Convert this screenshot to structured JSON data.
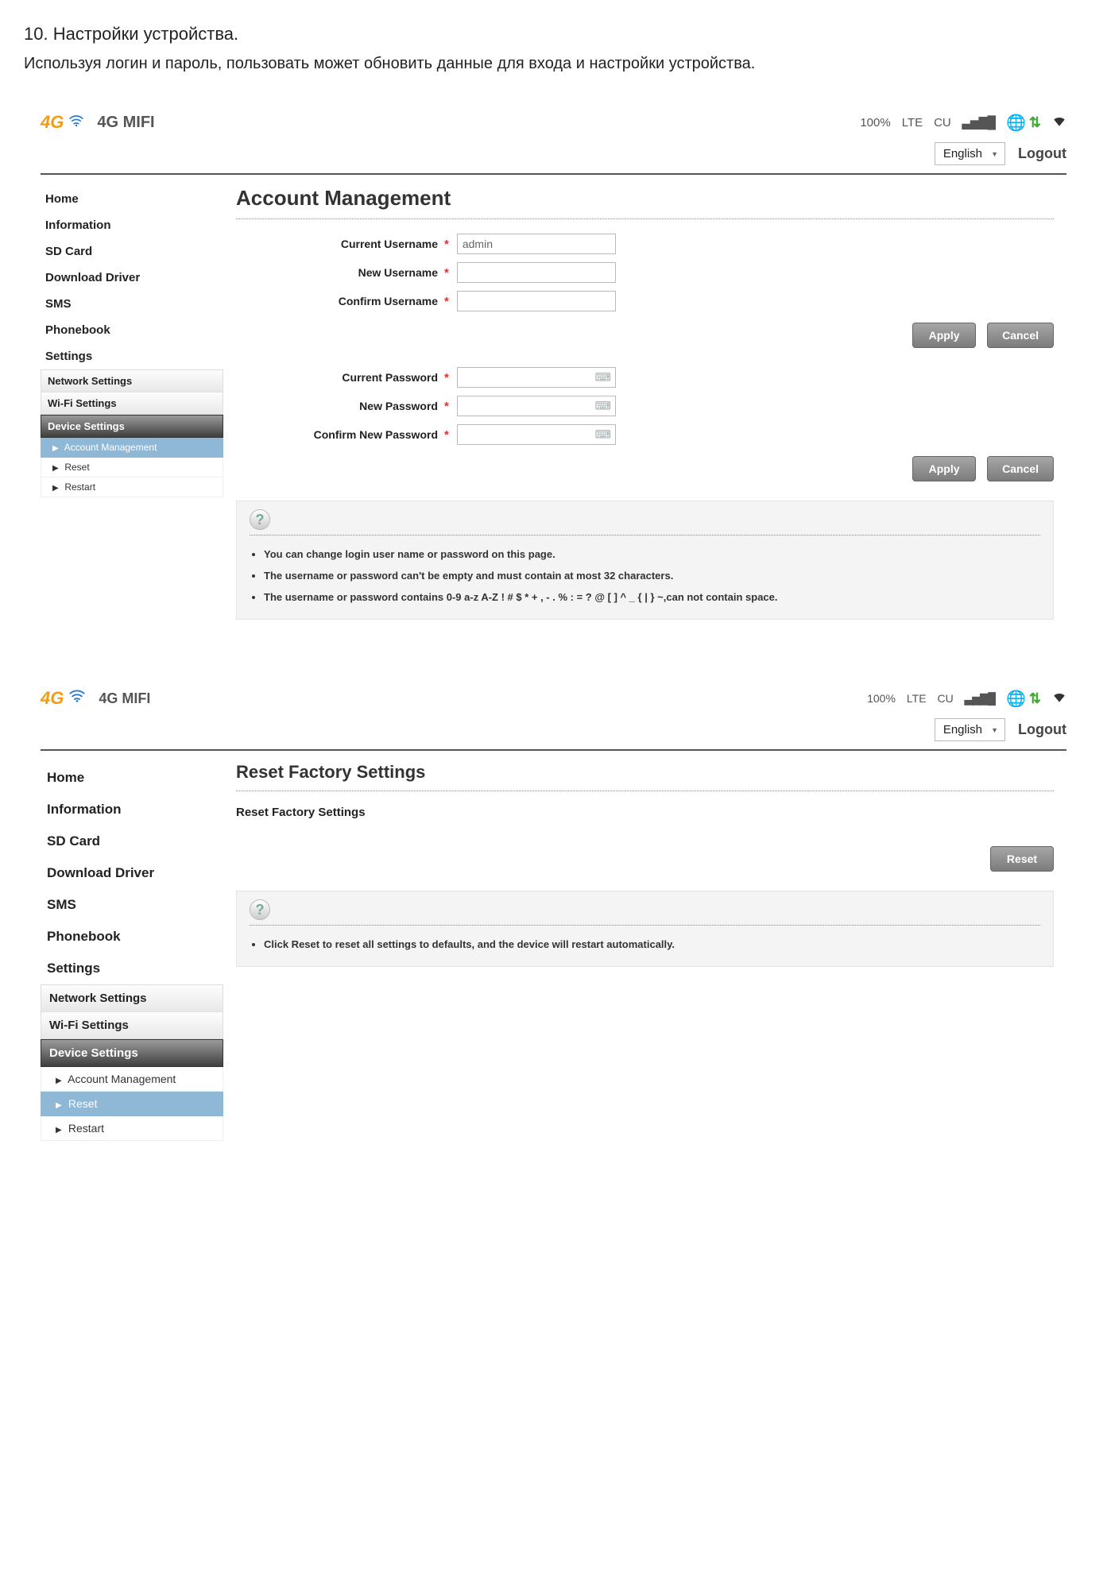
{
  "doc": {
    "heading": "10. Настройки устройства.",
    "sub": "Используя логин и пароль, пользовать может обновить данные для входа и настройки устройства."
  },
  "common": {
    "brand": "4G MIFI",
    "logo4g": "4G",
    "status": {
      "battery": "100%",
      "net": "LTE",
      "carrier": "CU"
    },
    "lang": "English",
    "logout": "Logout",
    "nav": {
      "home": "Home",
      "information": "Information",
      "sdcard": "SD Card",
      "download": "Download Driver",
      "sms": "SMS",
      "phonebook": "Phonebook",
      "settings": "Settings",
      "network": "Network Settings",
      "wifi": "Wi-Fi Settings",
      "device": "Device Settings",
      "account": "Account Management",
      "reset": "Reset",
      "restart": "Restart"
    },
    "buttons": {
      "apply": "Apply",
      "cancel": "Cancel",
      "reset": "Reset"
    }
  },
  "panel1": {
    "title": "Account Management",
    "fields": {
      "cur_user": "Current Username",
      "new_user": "New Username",
      "conf_user": "Confirm Username",
      "cur_pw": "Current Password",
      "new_pw": "New Password",
      "conf_pw": "Confirm New Password"
    },
    "values": {
      "cur_user": "admin"
    },
    "help": [
      "You can change login user name or password on this page.",
      "The username or password can't be empty and must contain at most 32 characters.",
      "The username or password contains 0-9 a-z A-Z ! # $ * + , - . % : = ? @ [ ] ^ _ { | } ~,can not contain space."
    ]
  },
  "panel2": {
    "title": "Reset Factory Settings",
    "sub": "Reset Factory Settings",
    "help": [
      "Click Reset to reset all settings to defaults, and the device will restart automatically."
    ]
  }
}
